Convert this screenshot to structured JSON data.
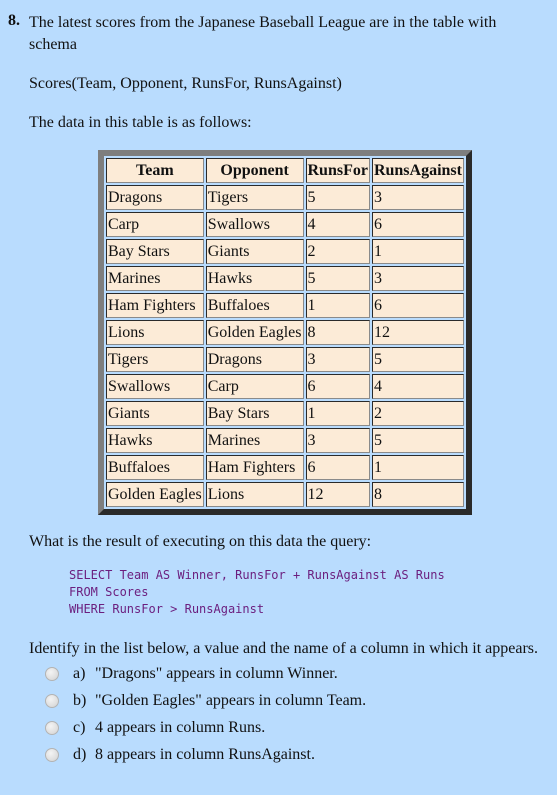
{
  "question": {
    "number": "8.",
    "intro": "The latest scores from the Japanese Baseball League are in the table with schema",
    "schema": "Scores(Team, Opponent, RunsFor, RunsAgainst)",
    "data_intro": "The data in this table is as follows:",
    "table": {
      "headers": [
        "Team",
        "Opponent",
        "RunsFor",
        "RunsAgainst"
      ],
      "rows": [
        [
          "Dragons",
          "Tigers",
          "5",
          "3"
        ],
        [
          "Carp",
          "Swallows",
          "4",
          "6"
        ],
        [
          "Bay Stars",
          "Giants",
          "2",
          "1"
        ],
        [
          "Marines",
          "Hawks",
          "5",
          "3"
        ],
        [
          "Ham Fighters",
          "Buffaloes",
          "1",
          "6"
        ],
        [
          "Lions",
          "Golden Eagles",
          "8",
          "12"
        ],
        [
          "Tigers",
          "Dragons",
          "3",
          "5"
        ],
        [
          "Swallows",
          "Carp",
          "6",
          "4"
        ],
        [
          "Giants",
          "Bay Stars",
          "1",
          "2"
        ],
        [
          "Hawks",
          "Marines",
          "3",
          "5"
        ],
        [
          "Buffaloes",
          "Ham Fighters",
          "6",
          "1"
        ],
        [
          "Golden Eagles",
          "Lions",
          "12",
          "8"
        ]
      ]
    },
    "query_prompt": "What is the result of executing on this data the query:",
    "sql": [
      "SELECT Team AS Winner, RunsFor + RunsAgainst AS Runs",
      "FROM Scores",
      "WHERE RunsFor > RunsAgainst"
    ],
    "identify": "Identify in the list below, a value and the name of a column in which it appears.",
    "options": [
      {
        "label": "a)",
        "text": "\"Dragons\" appears in column Winner."
      },
      {
        "label": "b)",
        "text": "\"Golden Eagles\" appears in column Team."
      },
      {
        "label": "c)",
        "text": "4 appears in column Runs."
      },
      {
        "label": "d)",
        "text": "8 appears in column RunsAgainst."
      }
    ]
  },
  "colors": {
    "background": "#b9dcfe",
    "cell": "#fcebd7",
    "sql_text": "#6b1e7e"
  }
}
